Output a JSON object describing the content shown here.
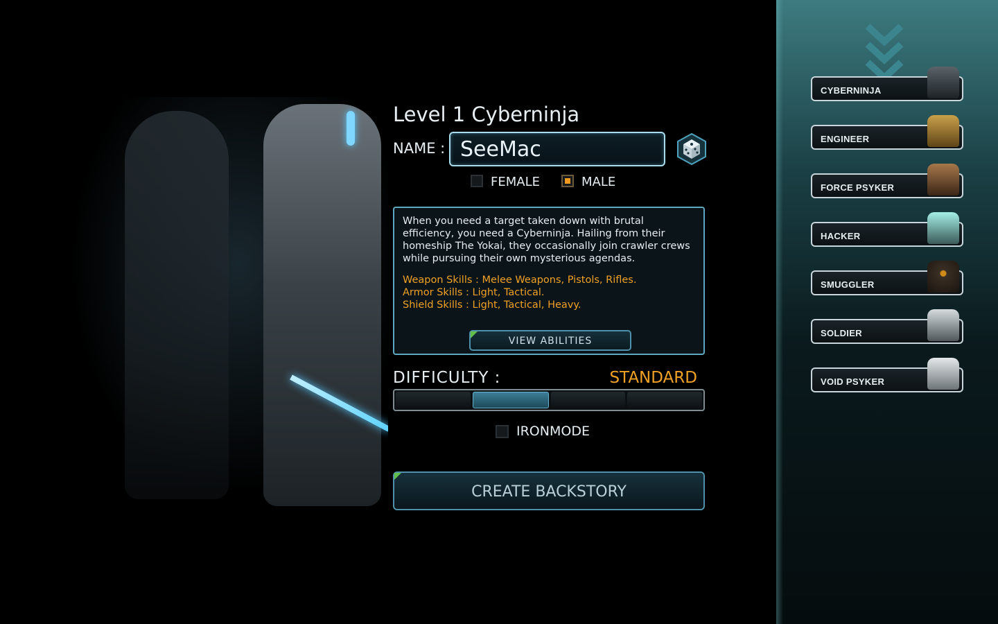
{
  "header": {
    "title": "Level 1 Cyberninja"
  },
  "name": {
    "label": "NAME :",
    "value": "SeeMac",
    "randomize_icon": "dice-icon"
  },
  "gender": {
    "female_label": "FEMALE",
    "male_label": "MALE",
    "selected": "MALE"
  },
  "description": {
    "text": "When you need a target taken down with brutal efficiency, you need a Cyberninja. Hailing from their homeship The Yokai, they occasionally join crawler crews while pursuing their own mysterious agendas.",
    "weapon_skills": "Weapon Skills : Melee Weapons, Pistols, Rifles.",
    "armor_skills": "Armor Skills : Light, Tactical.",
    "shield_skills": "Shield Skills : Light, Tactical, Heavy.",
    "view_button": "VIEW ABILITIES"
  },
  "difficulty": {
    "label": "DIFFICULTY :",
    "value": "STANDARD",
    "segments": 4,
    "selected_index": 1
  },
  "ironmode": {
    "label": "IRONMODE",
    "checked": false
  },
  "create_button": "CREATE BACKSTORY",
  "classes": [
    {
      "label": "CYBERNINJA",
      "portrait_color": "#1d2226",
      "selected": true
    },
    {
      "label": "ENGINEER",
      "portrait_color": "#8b6b2a"
    },
    {
      "label": "FORCE PSYKER",
      "portrait_color": "#6a4a2e"
    },
    {
      "label": "HACKER",
      "portrait_color": "#7fd1c9"
    },
    {
      "label": "SMUGGLER",
      "portrait_color": "#3b2f24"
    },
    {
      "label": "SOLDIER",
      "portrait_color": "#9aa3a8"
    },
    {
      "label": "VOID PSYKER",
      "portrait_color": "#b6bcc0"
    }
  ],
  "colors": {
    "accent_orange": "#f0a125",
    "accent_cyan": "#5fa8c2",
    "panel_teal": "#3d7b80"
  }
}
